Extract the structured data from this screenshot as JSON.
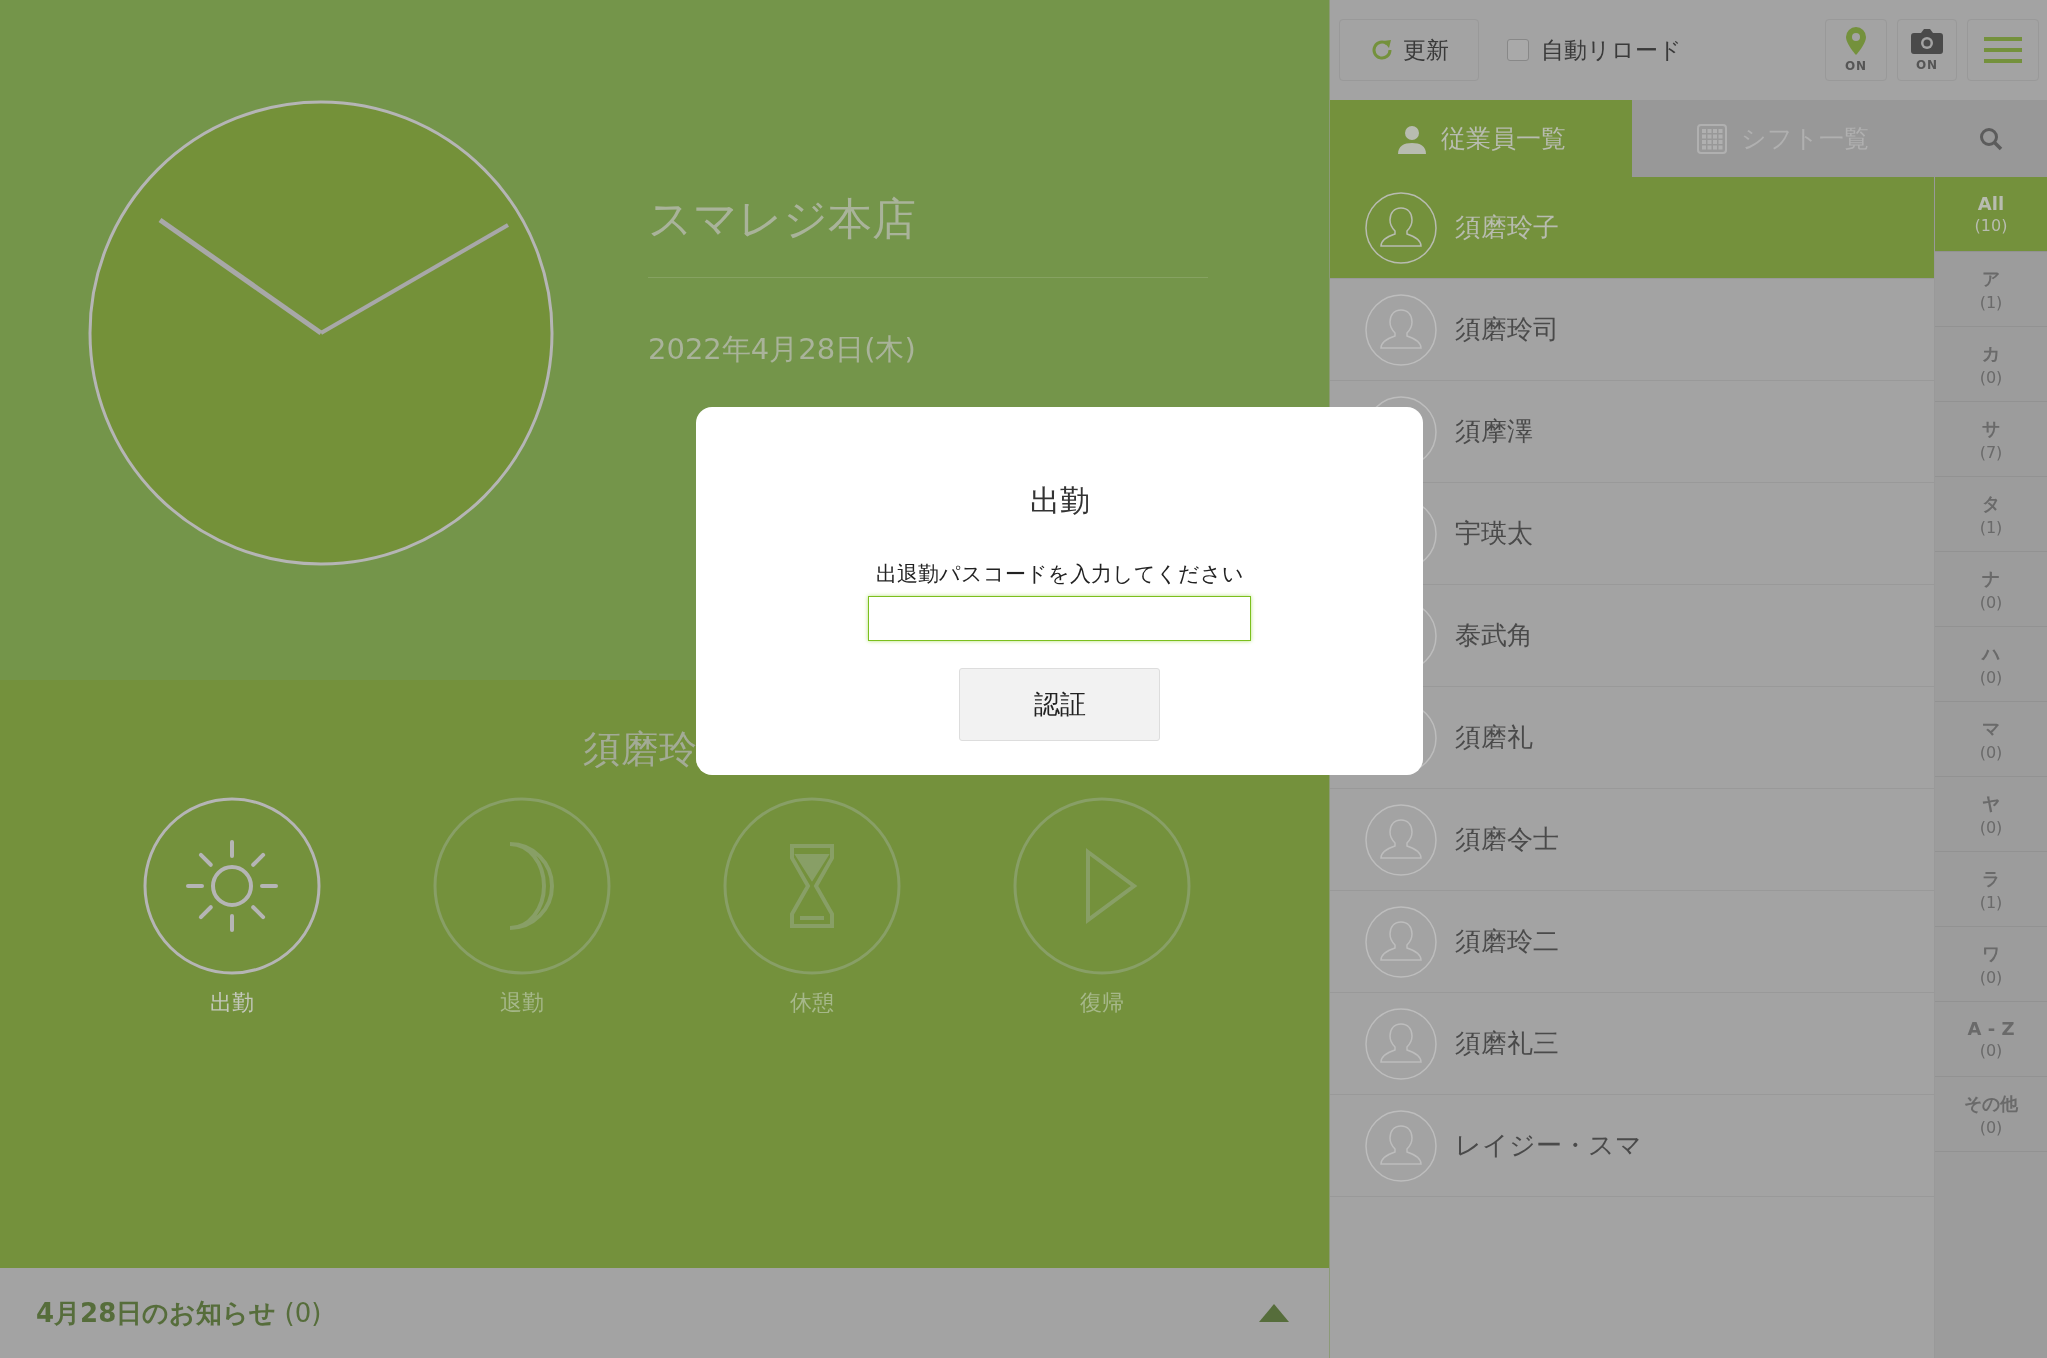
{
  "clock_panel": {
    "store_name": "スマレジ本店",
    "date": "2022年4月28日(木)"
  },
  "employee_name": "須磨玲",
  "actions": [
    {
      "label": "出勤",
      "kind": "sun",
      "disabled": false
    },
    {
      "label": "退勤",
      "kind": "moon",
      "disabled": true
    },
    {
      "label": "休憩",
      "kind": "hourglass",
      "disabled": true
    },
    {
      "label": "復帰",
      "kind": "play",
      "disabled": true
    }
  ],
  "notice_bar": {
    "label": "**4月28日のお知らせ** (0)"
  },
  "toolbar": {
    "refresh_button": "更新",
    "auto_reload": {
      "label": "自動リロード",
      "checked": false
    },
    "location_button": {
      "status": "ON"
    },
    "camera_button": {
      "status": "ON"
    }
  },
  "tabs": [
    {
      "label": "従業員一覧",
      "kind": "person",
      "selected": true
    },
    {
      "label": "シフト一覧",
      "kind": "grid",
      "selected": false
    }
  ],
  "employees": [
    {
      "name": "須磨玲子",
      "selected": true
    },
    {
      "name": "須磨玲司",
      "selected": false
    },
    {
      "name": "須摩澤",
      "selected": false
    },
    {
      "name": "宇瑛太",
      "selected": false
    },
    {
      "name": "泰武角",
      "selected": false
    },
    {
      "name": "須磨礼",
      "selected": false
    },
    {
      "name": "須磨令士",
      "selected": false
    },
    {
      "name": "須磨玲二",
      "selected": false
    },
    {
      "name": "須磨礼三",
      "selected": false
    },
    {
      "name": "レイジー・スマ",
      "selected": false
    }
  ],
  "index": [
    {
      "label": "All",
      "count": "(10)",
      "selected": true
    },
    {
      "label": "ア",
      "count": "(1)",
      "selected": false
    },
    {
      "label": "カ",
      "count": "(0)",
      "selected": false
    },
    {
      "label": "サ",
      "count": "(7)",
      "selected": false
    },
    {
      "label": "タ",
      "count": "(1)",
      "selected": false
    },
    {
      "label": "ナ",
      "count": "(0)",
      "selected": false
    },
    {
      "label": "ハ",
      "count": "(0)",
      "selected": false
    },
    {
      "label": "マ",
      "count": "(0)",
      "selected": false
    },
    {
      "label": "ヤ",
      "count": "(0)",
      "selected": false
    },
    {
      "label": "ラ",
      "count": "(1)",
      "selected": false
    },
    {
      "label": "ワ",
      "count": "(0)",
      "selected": false
    },
    {
      "label": "A - Z",
      "count": "(0)",
      "selected": false
    },
    {
      "label": "その他",
      "count": "(0)",
      "selected": false
    }
  ],
  "dialog": {
    "title": "出勤",
    "prompt": "出退勤パスコードを入力してください",
    "button": "認証"
  }
}
